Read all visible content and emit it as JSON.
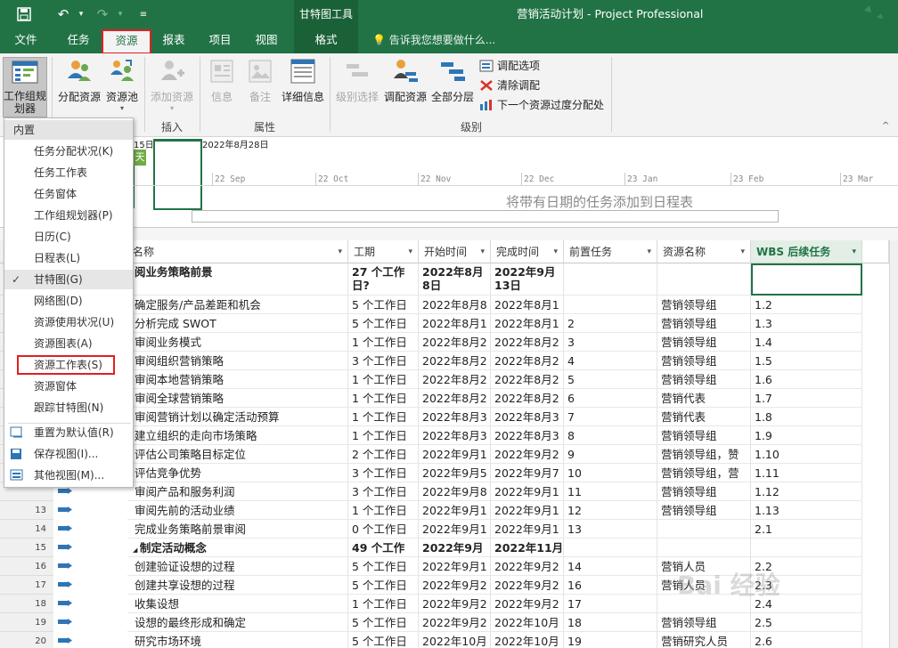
{
  "titlebar": {
    "context_tool": "甘特图工具",
    "title": "营销活动计划 - Project Professional"
  },
  "tabs": [
    "文件",
    "任务",
    "资源",
    "报表",
    "项目",
    "视图",
    "格式"
  ],
  "tell_me": "告诉我您想要做什么...",
  "ribbon": {
    "team_planner": "工作组规划器",
    "assign_resources": "分配资源",
    "resource_pool": "资源池",
    "add_resources": "添加资源",
    "info": "信息",
    "notes": "备注",
    "details": "详细信息",
    "level_selection": "级别选择",
    "level_resource": "调配资源",
    "level_all": "全部分层",
    "leveling_options": "调配选项",
    "clear_leveling": "清除调配",
    "next_overallocation": "下一个资源过度分配处",
    "group_insert": "插入",
    "group_properties": "属性",
    "group_level": "级别"
  },
  "timeline": {
    "date_left": "15日",
    "date_current": "2022年8月28日",
    "today_badge": "天",
    "ticks": [
      "22 Sep",
      "22 Oct",
      "22 Nov",
      "22 Dec",
      "23 Jan",
      "23 Feb",
      "23 Mar"
    ],
    "hint": "将带有日期的任务添加到日程表"
  },
  "columns": {
    "name": "名称",
    "duration": "工期",
    "start": "开始时间",
    "finish": "完成时间",
    "predecessors": "前置任务",
    "resources": "资源名称",
    "wbs": "WBS 后续任务"
  },
  "rows": [
    {
      "id": "",
      "name": "阅业务策略前景",
      "duration": "27 个工作日?",
      "start": "2022年8月8日",
      "finish": "2022年9月13日",
      "pred": "",
      "res": "",
      "wbs": "",
      "bold": true,
      "tall": true
    },
    {
      "id": "",
      "name": "确定服务/产品差距和机会",
      "duration": "5 个工作日",
      "start": "2022年8月8",
      "finish": "2022年8月1",
      "pred": "",
      "res": "营销领导组",
      "wbs": "1.2"
    },
    {
      "id": "",
      "name": "分析完成 SWOT",
      "duration": "5 个工作日",
      "start": "2022年8月1",
      "finish": "2022年8月1",
      "pred": "2",
      "res": "营销领导组",
      "wbs": "1.3"
    },
    {
      "id": "",
      "name": "审阅业务模式",
      "duration": "1 个工作日",
      "start": "2022年8月2",
      "finish": "2022年8月2",
      "pred": "3",
      "res": "营销领导组",
      "wbs": "1.4"
    },
    {
      "id": "",
      "name": "审阅组织营销策略",
      "duration": "3 个工作日",
      "start": "2022年8月2",
      "finish": "2022年8月2",
      "pred": "4",
      "res": "营销领导组",
      "wbs": "1.5"
    },
    {
      "id": "",
      "name": "审阅本地营销策略",
      "duration": "1 个工作日",
      "start": "2022年8月2",
      "finish": "2022年8月2",
      "pred": "5",
      "res": "营销领导组",
      "wbs": "1.6"
    },
    {
      "id": "",
      "name": "审阅全球营销策略",
      "duration": "1 个工作日",
      "start": "2022年8月2",
      "finish": "2022年8月2",
      "pred": "6",
      "res": "营销代表",
      "wbs": "1.7"
    },
    {
      "id": "",
      "name": "审阅营销计划以确定活动预算",
      "duration": "1 个工作日",
      "start": "2022年8月3",
      "finish": "2022年8月3",
      "pred": "7",
      "res": "营销代表",
      "wbs": "1.8"
    },
    {
      "id": "",
      "name": "建立组织的走向市场策略",
      "duration": "1 个工作日",
      "start": "2022年8月3",
      "finish": "2022年8月3",
      "pred": "8",
      "res": "营销领导组",
      "wbs": "1.9"
    },
    {
      "id": "",
      "name": "评估公司策略目标定位",
      "duration": "2 个工作日",
      "start": "2022年9月1",
      "finish": "2022年9月2",
      "pred": "9",
      "res": "营销领导组，赞",
      "wbs": "1.10"
    },
    {
      "id": "",
      "name": "评估竞争优势",
      "duration": "3 个工作日",
      "start": "2022年9月5",
      "finish": "2022年9月7",
      "pred": "10",
      "res": "营销领导组，营",
      "wbs": "1.11"
    },
    {
      "id": "",
      "name": "审阅产品和服务利润",
      "duration": "3 个工作日",
      "start": "2022年9月8",
      "finish": "2022年9月1",
      "pred": "11",
      "res": "营销领导组",
      "wbs": "1.12"
    },
    {
      "id": "13",
      "name": "审阅先前的活动业绩",
      "duration": "1 个工作日",
      "start": "2022年9月1",
      "finish": "2022年9月1",
      "pred": "12",
      "res": "营销领导组",
      "wbs": "1.13"
    },
    {
      "id": "14",
      "name": "完成业务策略前景审阅",
      "duration": "0 个工作日",
      "start": "2022年9月1",
      "finish": "2022年9月1",
      "pred": "13",
      "res": "",
      "wbs": "2.1"
    },
    {
      "id": "15",
      "name": "制定活动概念",
      "duration": "49 个工作",
      "start": "2022年9月",
      "finish": "2022年11月",
      "pred": "",
      "res": "",
      "wbs": "",
      "bold": true,
      "summary": true
    },
    {
      "id": "16",
      "name": "创建验证设想的过程",
      "duration": "5 个工作日",
      "start": "2022年9月1",
      "finish": "2022年9月2",
      "pred": "14",
      "res": "营销人员",
      "wbs": "2.2"
    },
    {
      "id": "17",
      "name": "创建共享设想的过程",
      "duration": "5 个工作日",
      "start": "2022年9月2",
      "finish": "2022年9月2",
      "pred": "16",
      "res": "营销人员",
      "wbs": "2.3"
    },
    {
      "id": "18",
      "name": "收集设想",
      "duration": "1 个工作日",
      "start": "2022年9月2",
      "finish": "2022年9月2",
      "pred": "17",
      "res": "",
      "wbs": "2.4"
    },
    {
      "id": "19",
      "name": "设想的最终形成和确定",
      "duration": "5 个工作日",
      "start": "2022年9月2",
      "finish": "2022年10月",
      "pred": "18",
      "res": "营销领导组",
      "wbs": "2.5"
    },
    {
      "id": "20",
      "name": "研究市场环境",
      "duration": "5 个工作日",
      "start": "2022年10月",
      "finish": "2022年10月",
      "pred": "19",
      "res": "营销研究人员",
      "wbs": "2.6"
    }
  ],
  "menu": {
    "header": "内置",
    "items": [
      "任务分配状况(K)",
      "任务工作表",
      "任务窗体",
      "工作组规划器(P)",
      "日历(C)",
      "日程表(L)",
      "甘特图(G)",
      "网络图(D)",
      "资源使用状况(U)",
      "资源图表(A)",
      "资源工作表(S)",
      "资源窗体",
      "跟踪甘特图(N)"
    ],
    "actions": [
      "重置为默认值(R)",
      "保存视图(I)...",
      "其他视图(M)..."
    ]
  },
  "watermark": "Bai 经验"
}
